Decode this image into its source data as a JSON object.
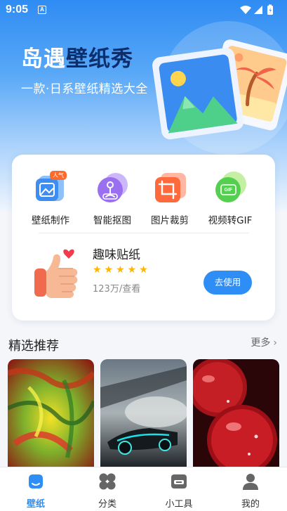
{
  "status_bar": {
    "time": "9:05",
    "notification_glyph": "A"
  },
  "hero": {
    "title_plain": "岛遇",
    "title_accent": "壁纸秀",
    "subtitle": "一款·日系壁纸精选大全"
  },
  "tools": [
    {
      "label": "壁纸制作",
      "badge": "人气",
      "icon": "image-edit-icon"
    },
    {
      "label": "智能抠图",
      "icon": "person-cutout-icon"
    },
    {
      "label": "图片裁剪",
      "icon": "crop-icon"
    },
    {
      "label": "视频转GIF",
      "badge": "GIF",
      "icon": "gif-icon"
    }
  ],
  "sticker": {
    "title": "趣味贴纸",
    "stars": "★★★★★",
    "rating": 5,
    "count": "123万/查看",
    "button": "去使用"
  },
  "recommend": {
    "title": "精选推荐",
    "more": "更多"
  },
  "tabbar": {
    "active": "壁纸",
    "items": [
      {
        "label": "壁纸",
        "icon": "wallpaper-icon"
      },
      {
        "label": "分类",
        "icon": "category-icon"
      },
      {
        "label": "小工具",
        "icon": "toolbox-icon"
      },
      {
        "label": "我的",
        "icon": "profile-icon"
      }
    ]
  },
  "colors": {
    "accent": "#2e8ef5",
    "hero_title_accent": "#0d2d6b",
    "star": "#ffb400"
  }
}
